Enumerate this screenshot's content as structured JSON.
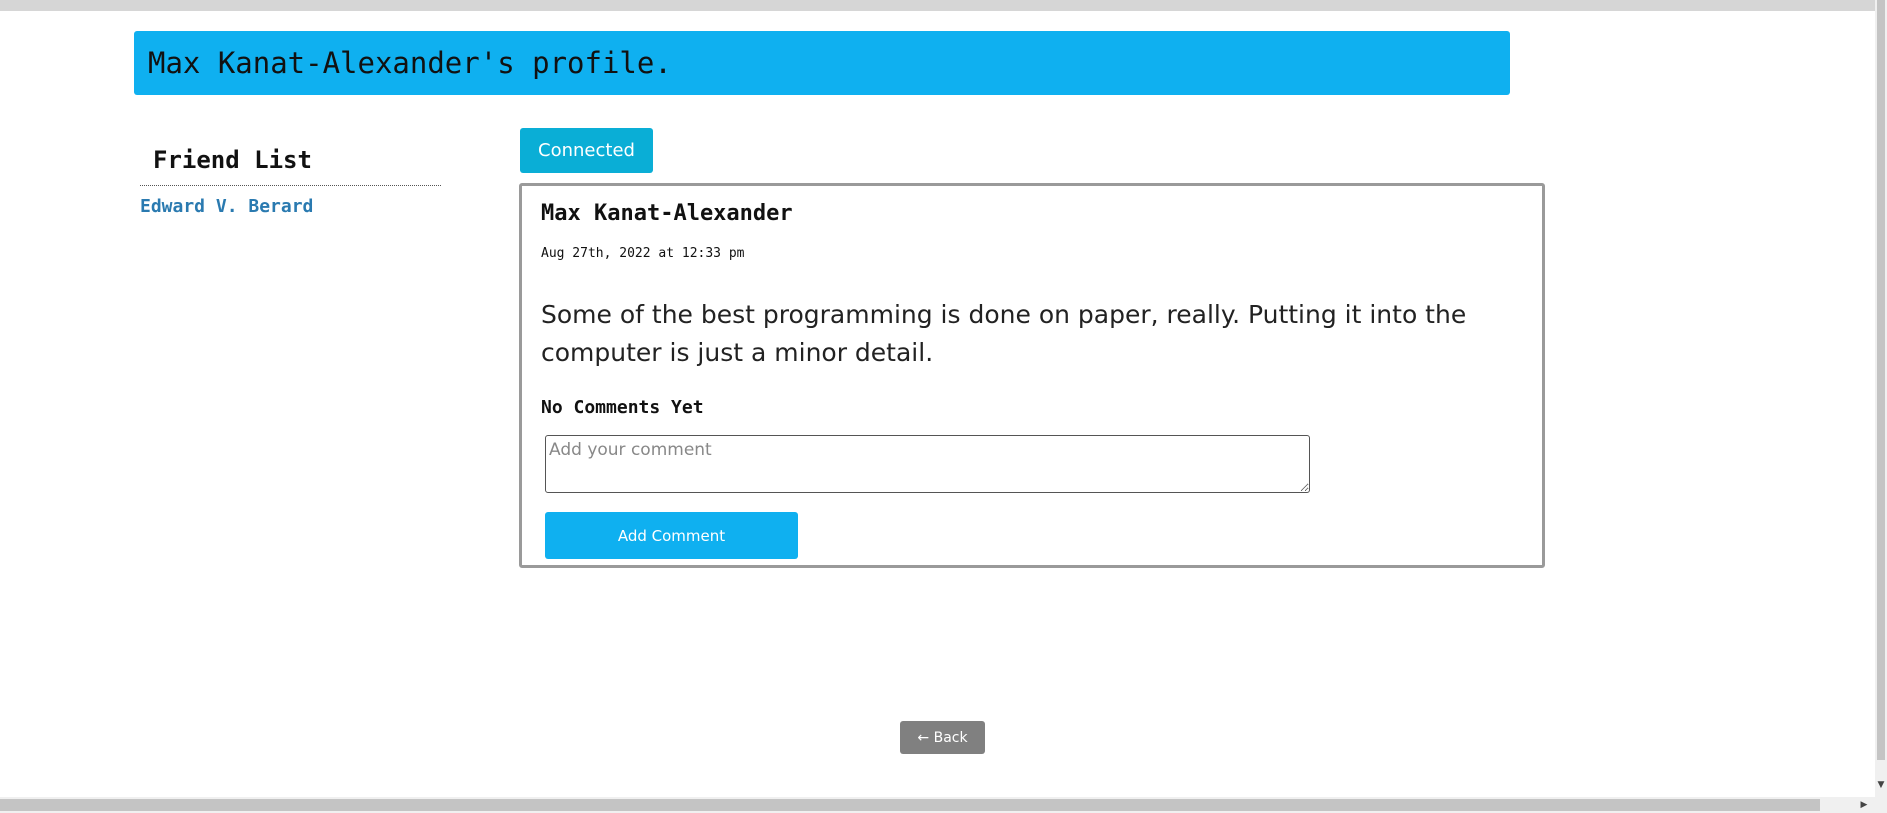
{
  "header": {
    "title": "Max Kanat-Alexander's profile."
  },
  "friends": {
    "title": "Friend List",
    "items": [
      {
        "name": "Edward V. Berard"
      }
    ]
  },
  "connection": {
    "status_label": "Connected"
  },
  "post": {
    "author": "Max Kanat-Alexander",
    "date": "Aug 27th, 2022 at 12:33 pm",
    "body": "Some of the best programming is done on paper, really. Putting it into the computer is just a minor detail.",
    "comments_status": "No Comments Yet",
    "comment_placeholder": "Add your comment",
    "add_comment_label": "Add Comment"
  },
  "navigation": {
    "back_label": "← Back"
  },
  "colors": {
    "header_bg": "#0fb0f0",
    "connected_bg": "#0aaed6",
    "link": "#2a7ab0",
    "back_bg": "#808080"
  },
  "icons": {
    "scroll_down": "triangle-down-icon",
    "scroll_right": "triangle-right-icon"
  }
}
